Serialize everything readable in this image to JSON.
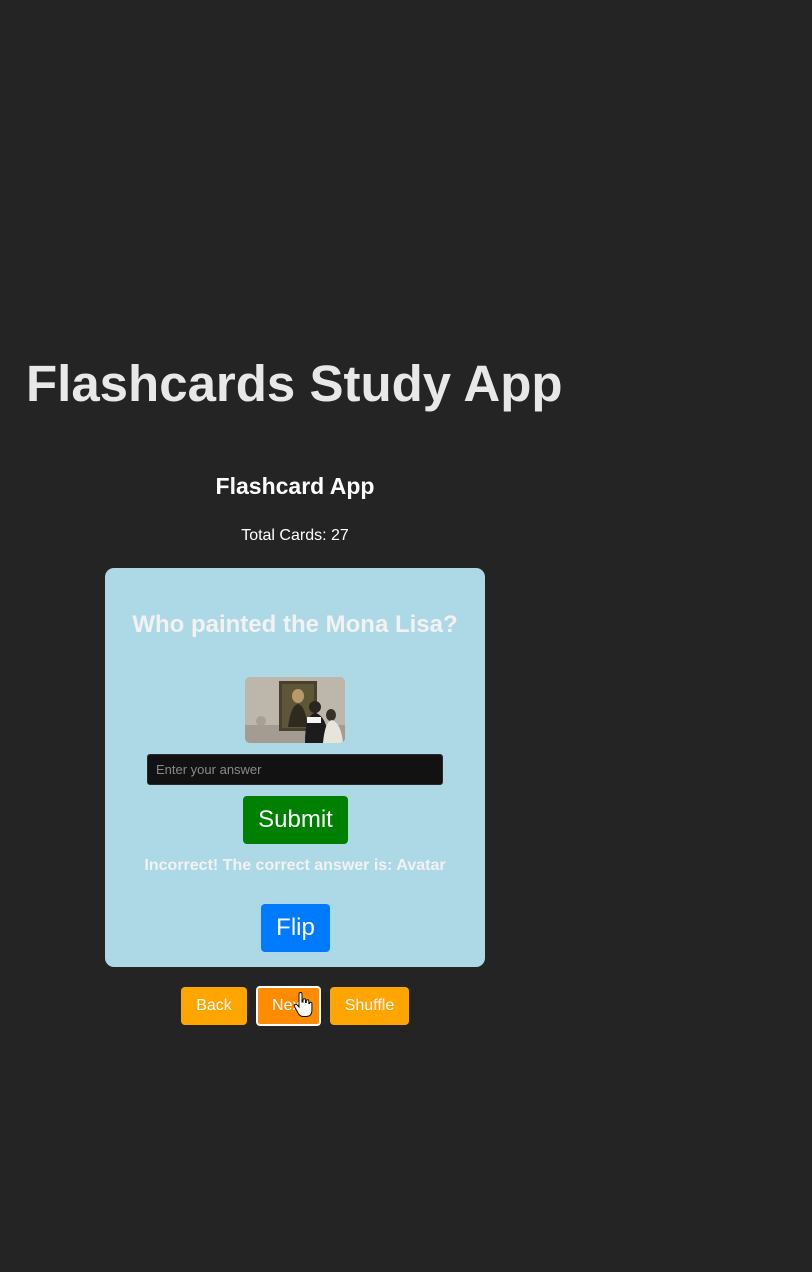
{
  "app": {
    "title": "Flashcards Study App",
    "subtitle": "Flashcard App",
    "total_cards": "Total Cards: 27"
  },
  "card": {
    "question": "Who painted the Mona Lisa?",
    "image_description": "Mona Lisa painting photo",
    "answer_input": {
      "value": "",
      "placeholder": "Enter your answer"
    },
    "submit_label": "Submit",
    "feedback": "Incorrect! The correct answer is: Avatar",
    "flip_label": "Flip"
  },
  "nav": {
    "back_label": "Back",
    "next_label": "Next",
    "shuffle_label": "Shuffle"
  },
  "colors": {
    "background": "#242424",
    "card": "#add8e6",
    "submit": "#008000",
    "flip": "#007bff",
    "nav": "#ffa500",
    "nav_active": "#ff8c00"
  },
  "icons": {
    "cursor": "hand-pointer-icon"
  }
}
